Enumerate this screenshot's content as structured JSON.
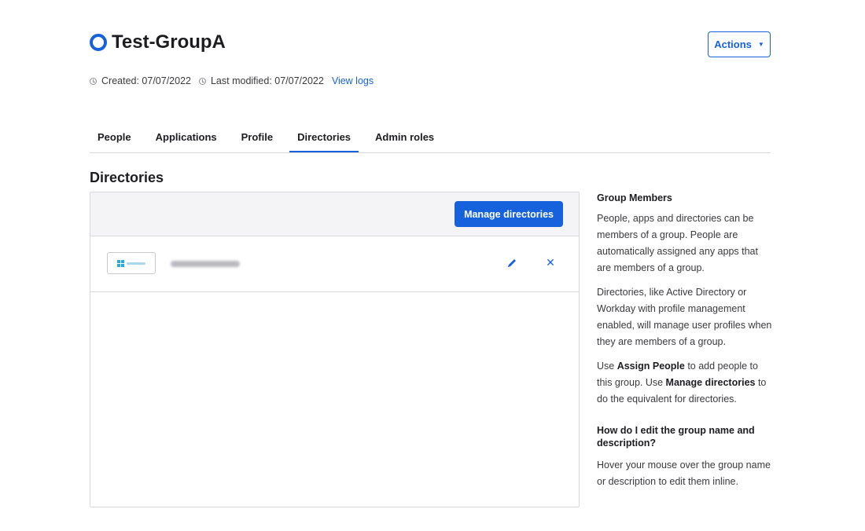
{
  "header": {
    "title": "Test-GroupA",
    "actions_label": "Actions",
    "created": "Created: 07/07/2022",
    "modified": "Last modified: 07/07/2022",
    "view_logs": "View logs"
  },
  "tabs": [
    {
      "label": "People",
      "active": false
    },
    {
      "label": "Applications",
      "active": false
    },
    {
      "label": "Profile",
      "active": false
    },
    {
      "label": "Directories",
      "active": true
    },
    {
      "label": "Admin roles",
      "active": false
    }
  ],
  "section_title": "Directories",
  "panel": {
    "manage_label": "Manage directories"
  },
  "sidebar": {
    "heading1": "Group Members",
    "p1": "People, apps and directories can be members of a group. People are automatically assigned any apps that are members of a group.",
    "p2": "Directories, like Active Directory or Workday with profile management enabled, will manage user profiles when they are members of a group.",
    "p3_a": "Use ",
    "p3_b": "Assign People",
    "p3_c": " to add people to this group. Use ",
    "p3_d": "Manage directories",
    "p3_e": " to do the equivalent for directories.",
    "heading2": "How do I edit the group name and description?",
    "p4": "Hover your mouse over the group name or description to edit them inline."
  },
  "colors": {
    "accent": "#1662dd",
    "border": "#d7d7dc",
    "toolbar_bg": "#f4f4f6"
  }
}
